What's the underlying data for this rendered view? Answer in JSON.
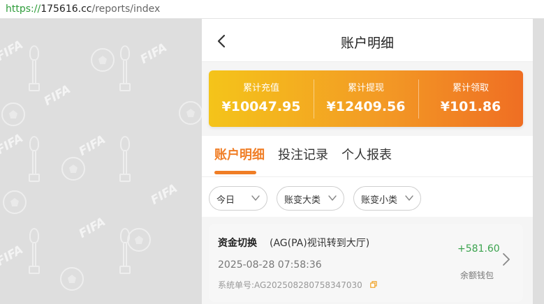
{
  "browser": {
    "url_scheme": "https://",
    "url_host": "175616.cc",
    "url_path": "/reports/index"
  },
  "background": {
    "pattern_text": "FIFA"
  },
  "header": {
    "title": "账户明细",
    "back_icon": "chevron-left-icon"
  },
  "summary": {
    "items": [
      {
        "label": "累计充值",
        "value": "¥10047.95"
      },
      {
        "label": "累计提现",
        "value": "¥12409.56"
      },
      {
        "label": "累计领取",
        "value": "¥101.86"
      }
    ],
    "gradient_colors": [
      "#f4c41a",
      "#f39a25",
      "#ef6e23"
    ]
  },
  "tabs": [
    {
      "label": "账户明细",
      "active": true
    },
    {
      "label": "投注记录",
      "active": false
    },
    {
      "label": "个人报表",
      "active": false
    }
  ],
  "filters": [
    {
      "label": "今日"
    },
    {
      "label": "账变大类"
    },
    {
      "label": "账变小类"
    }
  ],
  "records": [
    {
      "name": "资金切换",
      "description": "(AG(PA)视讯转到大厅)",
      "amount": "+581.60",
      "time": "2025-08-28 07:58:36",
      "order_label": "系统单号:",
      "order_number": "AG202508280758347030",
      "wallet": "余额钱包"
    }
  ],
  "colors": {
    "accent": "#f07e26",
    "positive_amount": "#3ba34e",
    "url_scheme": "#2e9c3a"
  }
}
